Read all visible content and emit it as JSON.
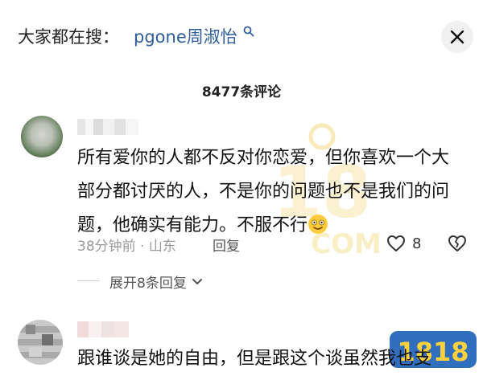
{
  "search": {
    "prefix": "大家都在搜：",
    "term": "pgone周淑怡"
  },
  "comments_count": "8477条评论",
  "comment1": {
    "lines": [
      "所有爱你的人都不反对你恋爱，但你喜欢一个大",
      "部分都讨厌的人，不是你的问题也不是我们的问",
      "题，他确实有能力。不服不行"
    ],
    "time": "38分钟前",
    "location": "山东",
    "reply_label": "回复",
    "likes": "8",
    "expand_label": "展开8条回复"
  },
  "comment2": {
    "text": "跟谁谈是她的自由，但是跟这个谈虽然我也支"
  },
  "watermark": {
    "text": "1818"
  },
  "colors": {
    "link": "#2f5d9c",
    "meta": "#9a9a9a",
    "watermark": "#f3cf5c"
  }
}
